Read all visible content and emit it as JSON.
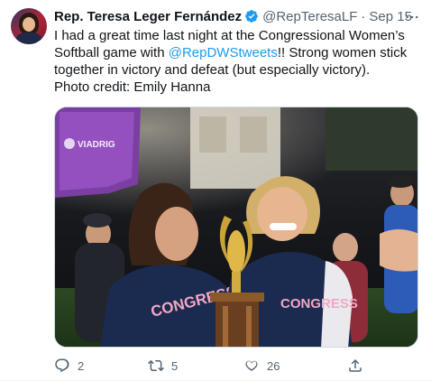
{
  "tweet": {
    "author_name": "Rep. Teresa Leger Fernández",
    "handle": "@RepTeresaLF",
    "separator": "·",
    "date": "Sep 15",
    "more_label": "···",
    "text_line1_before": "I had a great time last night at the Congressional Women’s Softball game with ",
    "mention": "@RepDWStweets",
    "text_line1_after": "!! Strong women stick together in victory and defeat (but especially victory).",
    "credit": "Photo credit: Emily Hanna",
    "photo_sign": "VIADRIG",
    "jersey_text": "CONGRESS",
    "stats": {
      "replies": "2",
      "retweets": "5",
      "likes": "26"
    }
  },
  "icons": {
    "verified": "verified-badge-icon",
    "more": "more-options-icon",
    "reply": "reply-icon",
    "retweet": "retweet-icon",
    "like": "heart-icon",
    "share": "share-icon"
  },
  "colors": {
    "accent": "#1d9bf0",
    "secondary_text": "#536471",
    "primary_text": "#0f1419"
  }
}
